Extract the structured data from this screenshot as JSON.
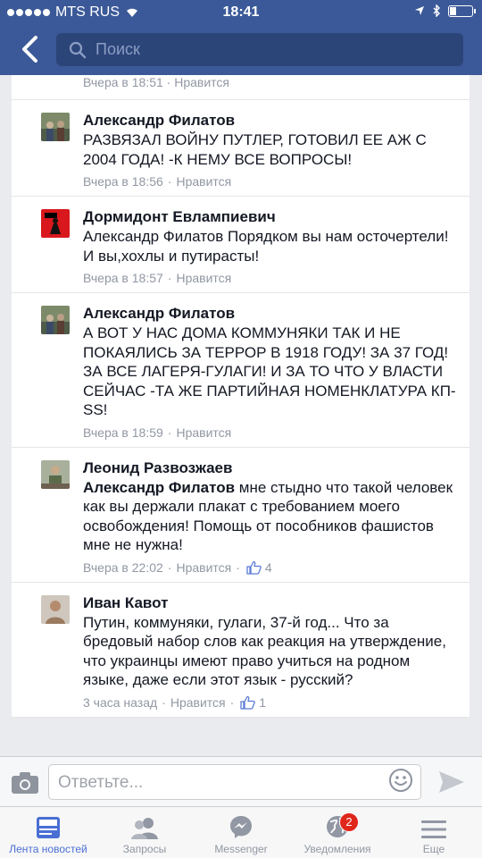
{
  "status": {
    "carrier": "MTS RUS",
    "time": "18:41"
  },
  "nav": {
    "search_placeholder": "Поиск"
  },
  "prev_meta": {
    "time": "Вчера в 18:51",
    "like": "Нравится"
  },
  "comments": [
    {
      "author": "Александр Филатов",
      "text": "РАЗВЯЗАЛ ВОЙНУ ПУТЛЕР, ГОТОВИЛ ЕЕ АЖ С 2004 ГОДА! -К НЕМУ ВСЕ ВОПРОСЫ!",
      "time": "Вчера в 18:56",
      "like": "Нравится"
    },
    {
      "author": "Дормидонт Евлампиевич",
      "text": "Александр Филатов Порядком вы нам осточертели! И вы,хохлы и путирасты!",
      "time": "Вчера в 18:57",
      "like": "Нравится"
    },
    {
      "author": "Александр Филатов",
      "text": "А ВОТ У НАС ДОМА КОММУНЯКИ ТАК И НЕ ПОКАЯЛИСЬ ЗА ТЕРРОР В 1918 ГОДУ! ЗА 37 ГОД! ЗА ВСЕ ЛАГЕРЯ-ГУЛАГИ! И ЗА ТО ЧТО У ВЛАСТИ СЕЙЧАС -ТА ЖЕ ПАРТИЙНАЯ НОМЕНКЛАТУРА КП-SS!",
      "time": "Вчера в 18:59",
      "like": "Нравится"
    },
    {
      "author": "Леонид Развозжаев",
      "mention": "Александр Филатов",
      "text": " мне стыдно что такой человек как вы держали плакат с требованием моего освобождения! Помощь от пособников фашистов мне не нужна!",
      "time": "Вчера в 22:02",
      "like": "Нравится",
      "likes": "4"
    },
    {
      "author": "Иван Кавот",
      "text": "Путин, коммуняки, гулаги, 37-й год... Что за бредовый набор слов как реакция на утверждение, что украинцы имеют право учиться на родном языке, даже если этот язык - русский?",
      "time": "3 часа назад",
      "like": "Нравится",
      "likes": "1"
    }
  ],
  "composer": {
    "placeholder": "Ответьте..."
  },
  "tabs": [
    {
      "label": "Лента новостей"
    },
    {
      "label": "Запросы"
    },
    {
      "label": "Messenger"
    },
    {
      "label": "Уведомления",
      "badge": "2"
    },
    {
      "label": "Еще"
    }
  ],
  "colors": {
    "brand": "#3b5998",
    "active_tab": "#4a6fd3",
    "badge": "#e0271b"
  }
}
